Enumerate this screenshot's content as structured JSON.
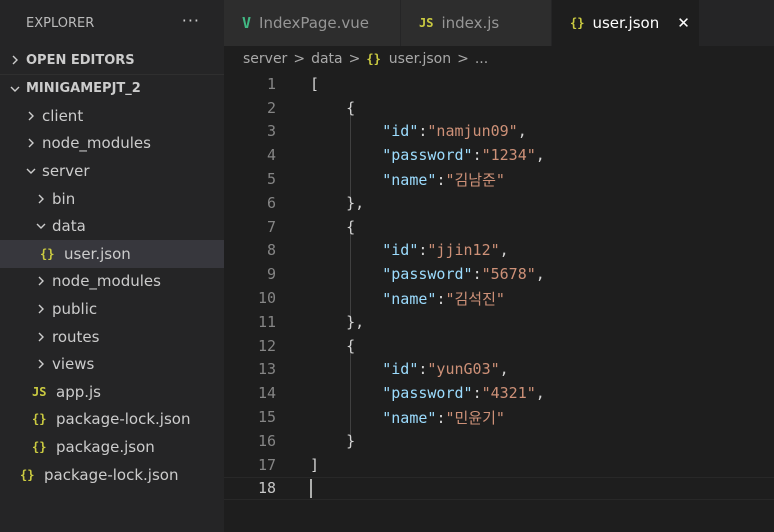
{
  "explorer": {
    "title": "EXPLORER",
    "more": "···",
    "open_editors": "OPEN EDITORS",
    "project": "MINIGAMEPJT_2",
    "tree": {
      "client": "client",
      "node_modules": "node_modules",
      "server": "server",
      "bin": "bin",
      "data": "data",
      "user_json": "user.json",
      "server_node_modules": "node_modules",
      "public": "public",
      "routes": "routes",
      "views": "views",
      "app_js": "app.js",
      "package_lock_json": "package-lock.json",
      "package_json": "package.json",
      "root_package_lock_json": "package-lock.json"
    },
    "icons": {
      "js": "JS",
      "json": "{}"
    }
  },
  "tabs": [
    {
      "label": "IndexPage.vue",
      "icon": "V"
    },
    {
      "label": "index.js",
      "icon": "JS"
    },
    {
      "label": "user.json",
      "icon": "{}",
      "close": "✕"
    }
  ],
  "breadcrumb": {
    "items": [
      "server",
      "data",
      "user.json",
      "..."
    ],
    "separator": ">"
  },
  "editor": {
    "line_numbers": [
      "1",
      "2",
      "3",
      "4",
      "5",
      "6",
      "7",
      "8",
      "9",
      "10",
      "11",
      "12",
      "13",
      "14",
      "15",
      "16",
      "17",
      "18"
    ],
    "tokens": {
      "open_bracket": "[",
      "close_bracket": "]",
      "open_brace": "{",
      "close_brace_comma": "},",
      "close_brace": "}",
      "k_id": "\"id\"",
      "k_password": "\"password\"",
      "k_name": "\"name\"",
      "colon": ":",
      "comma": ",",
      "v_id1": "\"namjun09\"",
      "v_pw1": "\"1234\"",
      "v_name1": "\"김남준\"",
      "v_id2": "\"jjin12\"",
      "v_pw2": "\"5678\"",
      "v_name2": "\"김석진\"",
      "v_id3": "\"yunG03\"",
      "v_pw3": "\"4321\"",
      "v_name3": "\"민윤기\""
    }
  },
  "colors": {
    "key": "#9cdcfe",
    "string": "#ce9178",
    "json_icon": "#cbcb41",
    "vue_icon": "#41b883"
  }
}
